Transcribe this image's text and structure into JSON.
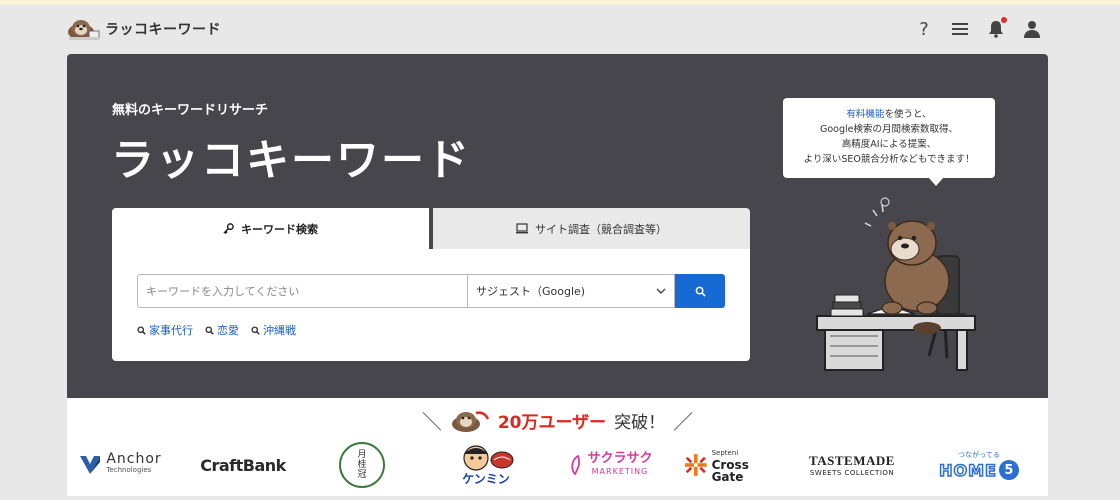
{
  "app": {
    "logo_text": "ラッコキーワード"
  },
  "header": {
    "icons": [
      "help-icon",
      "menu-icon",
      "bell-icon",
      "user-icon"
    ]
  },
  "hero": {
    "subtitle": "無料のキーワードリサーチ",
    "title": "ラッコキーワード"
  },
  "tabs": [
    {
      "label": "キーワード検索",
      "icon": "key-icon",
      "active": true
    },
    {
      "label": "サイト調査（競合調査等）",
      "icon": "monitor-icon",
      "active": false
    }
  ],
  "search": {
    "placeholder": "キーワードを入力してください",
    "value": "",
    "select_value": "サジェスト（Google)"
  },
  "suggestions": [
    "家事代行",
    "恋愛",
    "沖縄戦"
  ],
  "bubble": {
    "link": "有料機能",
    "line1_rest": "を使うと、",
    "line2": "Google検索の月間検索数取得、",
    "line3": "高精度AIによる提案、",
    "line4": "より深いSEO競合分析などもできます！"
  },
  "banner": {
    "slash_left": "＼",
    "highlight": "20万ユーザー",
    "rest": "突破！",
    "slash_right": "／"
  },
  "partners": {
    "anchor": "Anchor",
    "anchor_sub": "Technologies",
    "craftbank": "CraftBank",
    "gekkeikan_1": "月",
    "gekkeikan_2": "桂",
    "gekkeikan_3": "冠",
    "kenmin": "ケンミン",
    "sakurasaku": "サクラサク",
    "sakurasaku_sub": "MARKETING",
    "septeni_small": "Septeni",
    "septeni": "Cross Gate",
    "tastemade": "TASTEMADE",
    "tastemade_sub": "SWEETS COLLECTION",
    "home5_small": "つながってる",
    "home5": "HOME",
    "home5_num": "5"
  },
  "colors": {
    "hero_bg": "#46464c",
    "accent": "#1769d4",
    "link": "#1a5fc4",
    "highlight": "#e0261f"
  }
}
